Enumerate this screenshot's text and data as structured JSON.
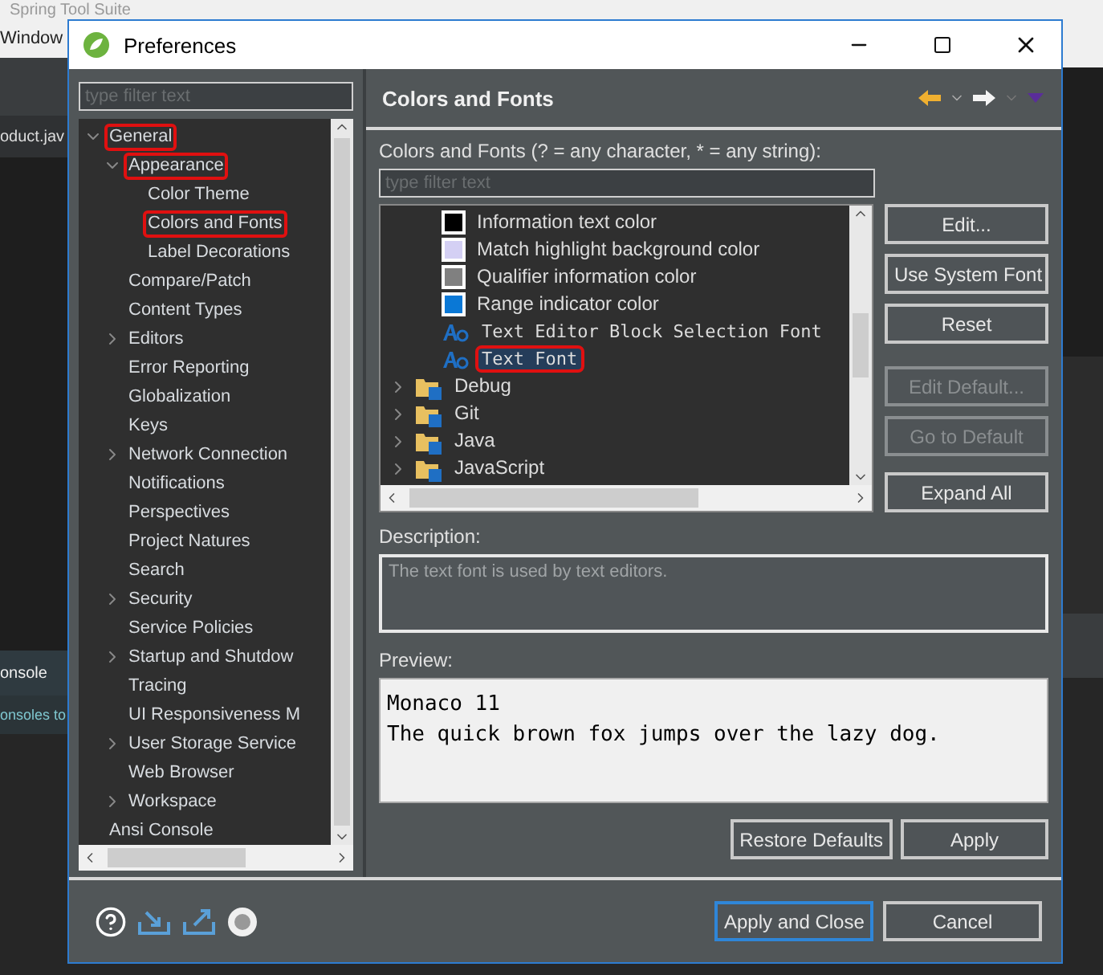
{
  "ide": {
    "title": "Spring Tool Suite",
    "menu": "Window",
    "editor_tab": "oduct.jav",
    "console_tab": "onsole",
    "console_text": "onsoles to"
  },
  "window": {
    "title": "Preferences"
  },
  "sidebar": {
    "filter": {
      "placeholder": "type filter text"
    },
    "items": [
      {
        "label": "General",
        "expanded": true,
        "annotated": true,
        "children": [
          {
            "label": "Appearance",
            "expanded": true,
            "annotated": true,
            "children": [
              {
                "label": "Color Theme",
                "annotated": false
              },
              {
                "label": "Colors and Fonts",
                "annotated": true
              },
              {
                "label": "Label Decorations",
                "annotated": false
              }
            ]
          },
          {
            "label": "Compare/Patch",
            "annotated": false
          },
          {
            "label": "Content Types",
            "annotated": false
          },
          {
            "label": "Editors",
            "expanded": false,
            "annotated": false
          },
          {
            "label": "Error Reporting",
            "annotated": false
          },
          {
            "label": "Globalization",
            "annotated": false
          },
          {
            "label": "Keys",
            "annotated": false
          },
          {
            "label": "Network Connection",
            "expanded": false,
            "annotated": false
          },
          {
            "label": "Notifications",
            "annotated": false
          },
          {
            "label": "Perspectives",
            "annotated": false
          },
          {
            "label": "Project Natures",
            "annotated": false
          },
          {
            "label": "Search",
            "annotated": false
          },
          {
            "label": "Security",
            "expanded": false,
            "annotated": false
          },
          {
            "label": "Service Policies",
            "annotated": false
          },
          {
            "label": "Startup and Shutdow",
            "expanded": false,
            "annotated": false
          },
          {
            "label": "Tracing",
            "annotated": false
          },
          {
            "label": "UI Responsiveness M",
            "annotated": false
          },
          {
            "label": "User Storage Service",
            "expanded": false,
            "annotated": false
          },
          {
            "label": "Web Browser",
            "annotated": false
          },
          {
            "label": "Workspace",
            "expanded": false,
            "annotated": false
          }
        ]
      },
      {
        "label": "Ansi Console",
        "annotated": false
      }
    ]
  },
  "page": {
    "title": "Colors and Fonts",
    "filter_label": "Colors and Fonts (? = any character, * = any string):",
    "filter": {
      "placeholder": "type filter text"
    },
    "items": [
      {
        "label": "Information text color",
        "kind": "color",
        "color": "#000000",
        "selected": false,
        "annotated": false
      },
      {
        "label": "Match highlight background color",
        "kind": "color",
        "color": "#d4d0f4",
        "selected": false,
        "annotated": false
      },
      {
        "label": "Qualifier information color",
        "kind": "color",
        "color": "#808080",
        "selected": false,
        "annotated": false
      },
      {
        "label": "Range indicator color",
        "kind": "color",
        "color": "#0a78d6",
        "selected": false,
        "annotated": false
      },
      {
        "label": "Text Editor Block Selection Font",
        "kind": "font",
        "selected": false,
        "annotated": false
      },
      {
        "label": "Text Font",
        "kind": "font",
        "selected": true,
        "annotated": true
      },
      {
        "label": "Debug",
        "kind": "category",
        "expanded": false,
        "selected": false,
        "annotated": false
      },
      {
        "label": "Git",
        "kind": "category",
        "expanded": false,
        "selected": false,
        "annotated": false
      },
      {
        "label": "Java",
        "kind": "category",
        "expanded": false,
        "selected": false,
        "annotated": false
      },
      {
        "label": "JavaScript",
        "kind": "category",
        "expanded": false,
        "selected": false,
        "annotated": false
      }
    ],
    "buttons": [
      {
        "label": "Edit...",
        "disabled": false
      },
      {
        "label": "Use System Font",
        "disabled": false
      },
      {
        "label": "Reset",
        "disabled": false
      },
      {
        "label": "Edit Default...",
        "disabled": true
      },
      {
        "label": "Go to Default",
        "disabled": true
      },
      {
        "label": "Expand All",
        "disabled": false
      }
    ],
    "description_label": "Description:",
    "description": "The text font is used by text editors.",
    "preview_label": "Preview:",
    "preview_lines": [
      "Monaco 11",
      "The quick brown fox jumps over the lazy dog."
    ],
    "actions": [
      "Restore Defaults",
      "Apply"
    ]
  },
  "footer": {
    "buttons": [
      {
        "label": "Apply and Close",
        "default": true
      },
      {
        "label": "Cancel",
        "default": false
      }
    ]
  }
}
